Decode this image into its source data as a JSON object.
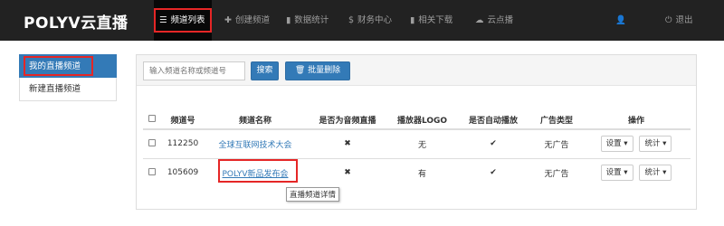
{
  "brand": "POLYV云直播",
  "nav": {
    "items": [
      {
        "label": "频道列表",
        "icon": "list-icon"
      },
      {
        "label": "创建频道",
        "icon": "plus-icon"
      },
      {
        "label": "数据统计",
        "icon": "bar-chart-icon"
      },
      {
        "label": "财务中心",
        "icon": "dollar-icon"
      },
      {
        "label": "相关下载",
        "icon": "bar-chart-icon"
      },
      {
        "label": "云点播",
        "icon": "cloud-icon"
      }
    ],
    "logout": "退出"
  },
  "sidebar": {
    "items": [
      {
        "label": "我的直播频道"
      },
      {
        "label": "新建直播频道"
      }
    ]
  },
  "toolbar": {
    "search_placeholder": "输入频道名称或频道号",
    "search_button": "搜索",
    "batch_delete": "批量删除"
  },
  "table": {
    "headers": [
      "频道号",
      "频道名称",
      "是否为音频直播",
      "播放器LOGO",
      "是否自动播放",
      "广告类型",
      "操作"
    ],
    "rows": [
      {
        "id": "112250",
        "name": "全球互联网技术大会",
        "audio": "✖",
        "logo": "无",
        "autoplay": "✔",
        "ad": "无广告",
        "settings": "设置",
        "stats": "统计"
      },
      {
        "id": "105609",
        "name": "POLYV新品发布会",
        "audio": "✖",
        "logo": "有",
        "autoplay": "✔",
        "ad": "无广告",
        "settings": "设置",
        "stats": "统计"
      }
    ]
  },
  "tooltip": "直播频道详情",
  "colors": {
    "navbar": "#222222",
    "primary": "#337ab7",
    "highlight": "#e52626"
  }
}
